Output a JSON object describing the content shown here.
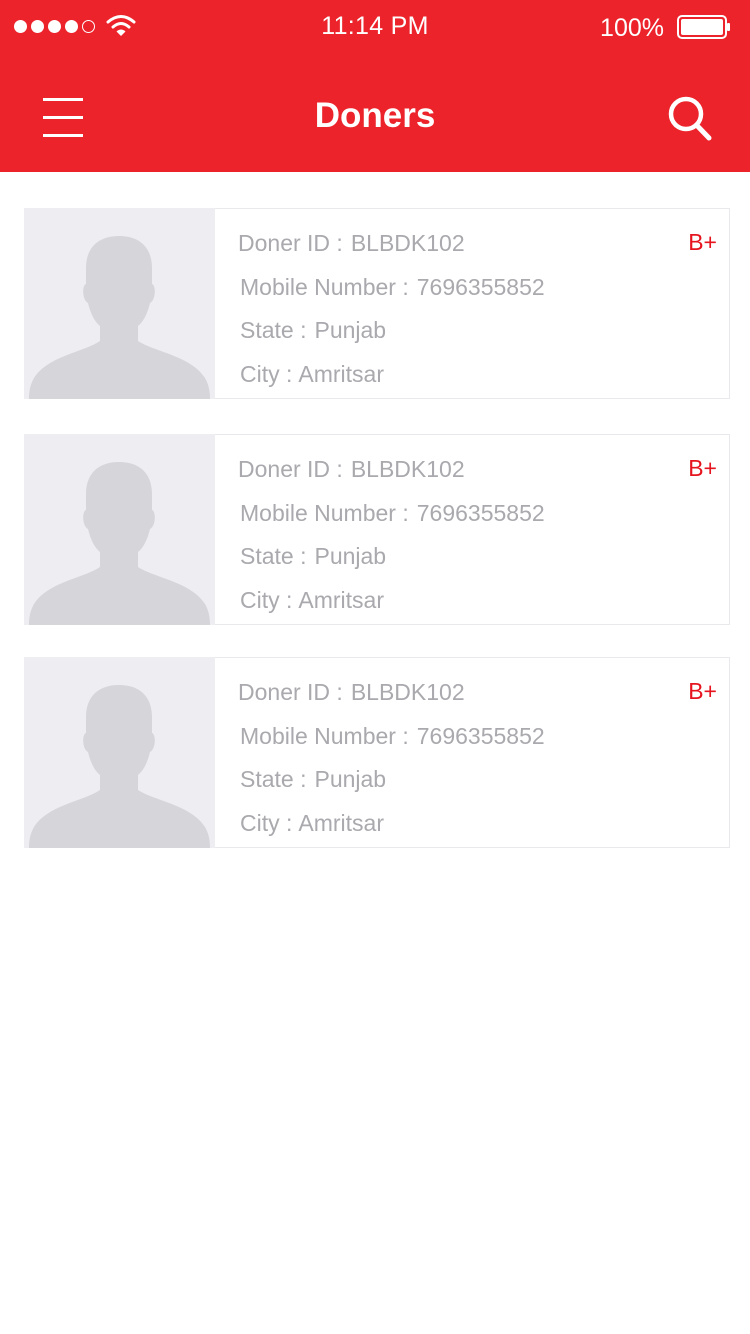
{
  "status_bar": {
    "time": "11:14 PM",
    "battery_percent": "100%",
    "signal_bars_filled": 4,
    "signal_bars_total": 5
  },
  "nav": {
    "title": "Doners",
    "menu_icon": "hamburger-menu-icon",
    "search_icon": "search-icon"
  },
  "colors": {
    "brand_red": "#ec232b",
    "blood_group_red": "#e5141e",
    "text_gray": "#a9a9ae",
    "avatar_bg": "#ededf2"
  },
  "donors": [
    {
      "id_label": "Doner ID :",
      "id_value": "BLBDK102",
      "mobile_label": "Mobile Number :",
      "mobile_value": "7696355852",
      "state_label": "State :",
      "state_value": "Punjab",
      "city_label": "City :",
      "city_value": "Amritsar",
      "blood_group": "B+"
    },
    {
      "id_label": "Doner ID :",
      "id_value": "BLBDK102",
      "mobile_label": "Mobile Number :",
      "mobile_value": "7696355852",
      "state_label": "State :",
      "state_value": "Punjab",
      "city_label": "City :",
      "city_value": "Amritsar",
      "blood_group": "B+"
    },
    {
      "id_label": "Doner ID :",
      "id_value": "BLBDK102",
      "mobile_label": "Mobile Number :",
      "mobile_value": "7696355852",
      "state_label": "State :",
      "state_value": "Punjab",
      "city_label": "City :",
      "city_value": "Amritsar",
      "blood_group": "B+"
    }
  ]
}
